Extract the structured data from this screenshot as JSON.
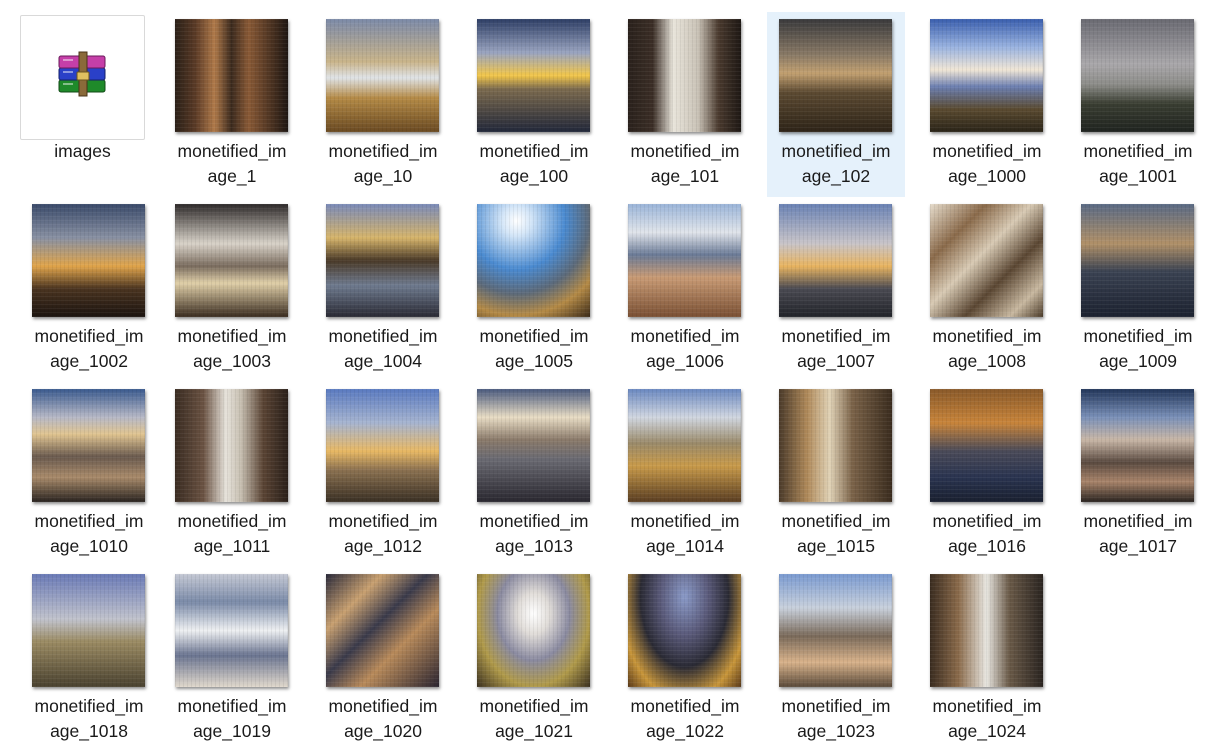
{
  "items": [
    {
      "type": "archive",
      "label": "images",
      "icon": "winrar-archive-icon"
    },
    {
      "type": "image",
      "l1": "monetified_im",
      "l2": "age_1",
      "bg": "linear-gradient(90deg,#2a2018 0%,#5a3a26 18%,#b07a4a 35%,#3b2a1e 50%,#8a5a36 65%,#1e1612 100%)"
    },
    {
      "type": "image",
      "l1": "monetified_im",
      "l2": "age_10",
      "bg": "linear-gradient(180deg,#7c8aa8 0%,#c9b48a 38%,#dfe3e6 52%,#b48a46 70%,#6a4a22 100%)"
    },
    {
      "type": "image",
      "l1": "monetified_im",
      "l2": "age_100",
      "bg": "linear-gradient(180deg,#2e3f66 0%,#9aa4c0 30%,#f2c64a 50%,#7b6a4e 62%,#22283a 100%)"
    },
    {
      "type": "image",
      "l1": "monetified_im",
      "l2": "age_101",
      "bg": "linear-gradient(90deg,#2a211c 0%,#3b2e26 22%,#e8e4da 40%,#c9c2b6 62%,#4a3a2e 80%,#1e1814 100%)"
    },
    {
      "type": "image",
      "l1": "monetified_im",
      "l2": "age_102",
      "bg": "linear-gradient(180deg,#3a3a3c 0%,#8a7a66 32%,#c2a070 48%,#5c4a32 65%,#2e2418 100%)",
      "selected": true
    },
    {
      "type": "image",
      "l1": "monetified_im",
      "l2": "age_1000",
      "bg": "linear-gradient(180deg,#3a5fae 0%,#9ab3e0 25%,#f0e6d6 45%,#6b7eb0 60%,#5a4a30 80%,#2a2418 100%)"
    },
    {
      "type": "image",
      "l1": "monetified_im",
      "l2": "age_1001",
      "bg": "linear-gradient(180deg,#6a6a72 0%,#a9a7aa 40%,#8c8c88 58%,#3a3e32 75%,#202420 100%)"
    },
    {
      "type": "image",
      "l1": "monetified_im",
      "l2": "age_1002",
      "bg": "linear-gradient(180deg,#3a4a6a 0%,#8890a2 30%,#e0a44a 55%,#4a3420 75%,#1c1410 100%)"
    },
    {
      "type": "image",
      "l1": "monetified_im",
      "l2": "age_1003",
      "bg": "linear-gradient(180deg,#2e2a2a 0%,#d8d2c8 35%,#7a6c5e 55%,#e0cfa8 70%,#3a2c20 100%)"
    },
    {
      "type": "image",
      "l1": "monetified_im",
      "l2": "age_1004",
      "bg": "linear-gradient(180deg,#7a8ab8 0%,#d6b46a 30%,#4a3a28 50%,#6e7a8e 72%,#2a2a34 100%)"
    },
    {
      "type": "image",
      "l1": "monetified_im",
      "l2": "age_1005",
      "bg": "radial-gradient(circle at 35% 15%,#ffffff 0%,#d4e6f8 12%,#4a8ad0 40%,#5c6a7a 60%,#b48a46 78%,#3a2a18 100%)"
    },
    {
      "type": "image",
      "l1": "monetified_im",
      "l2": "age_1006",
      "bg": "linear-gradient(180deg,#9ab4d8 0%,#e0e4ea 25%,#6a7a96 45%,#c89a74 65%,#7a5034 100%)"
    },
    {
      "type": "image",
      "l1": "monetified_im",
      "l2": "age_1007",
      "bg": "linear-gradient(180deg,#6a82b4 0%,#c8c4c8 35%,#e8b460 55%,#4a4a52 75%,#22242a 100%)"
    },
    {
      "type": "image",
      "l1": "monetified_im",
      "l2": "age_1008",
      "bg": "linear-gradient(135deg,#e6dccc 0%,#8a6a4a 25%,#d8cab4 45%,#5a4632 65%,#c8b8a0 85%,#4a3a28 100%)"
    },
    {
      "type": "image",
      "l1": "monetified_im",
      "l2": "age_1009",
      "bg": "linear-gradient(180deg,#5a6a84 0%,#b09068 35%,#3a4252 60%,#1c2230 100%)"
    },
    {
      "type": "image",
      "l1": "monetified_im",
      "l2": "age_1010",
      "bg": "linear-gradient(180deg,#3a5a8e 0%,#b6b8c6 25%,#e0c490 40%,#6a5a4e 60%,#a88a6a 78%,#2a2420 100%)"
    },
    {
      "type": "image",
      "l1": "monetified_im",
      "l2": "age_1011",
      "bg": "linear-gradient(90deg,#3a2c22 0%,#6a5242 25%,#e6e2da 45%,#c8c0b2 58%,#5a4434 78%,#2a201a 100%)"
    },
    {
      "type": "image",
      "l1": "monetified_im",
      "l2": "age_1012",
      "bg": "linear-gradient(180deg,#5a7ac0 0%,#a6b4d0 30%,#e8b864 55%,#8a7050 72%,#3a3024 100%)"
    },
    {
      "type": "image",
      "l1": "monetified_im",
      "l2": "age_1013",
      "bg": "linear-gradient(180deg,#4a5a7e 0%,#e8dcc4 25%,#8a7a6a 45%,#6a6a72 62%,#2a2830 100%)"
    },
    {
      "type": "image",
      "l1": "monetified_im",
      "l2": "age_1014",
      "bg": "linear-gradient(180deg,#6a88c0 0%,#d0d6e0 25%,#9a8a6a 48%,#c89a4a 68%,#5a3e22 100%)"
    },
    {
      "type": "image",
      "l1": "monetified_im",
      "l2": "age_1015",
      "bg": "linear-gradient(90deg,#4a3a2a 0%,#b08a5a 25%,#e0d2b6 45%,#7a6248 65%,#3a2c1e 100%)"
    },
    {
      "type": "image",
      "l1": "monetified_im",
      "l2": "age_1016",
      "bg": "linear-gradient(180deg,#8a5a2a 0%,#c8843a 30%,#4a4a58 55%,#2a3450 78%,#1a2030 100%)"
    },
    {
      "type": "image",
      "l1": "monetified_im",
      "l2": "age_1017",
      "bg": "linear-gradient(180deg,#22365a 0%,#7a90b8 25%,#c8b6a6 45%,#5a4a40 65%,#a8846a 82%,#2a2420 100%)"
    },
    {
      "type": "image",
      "l1": "monetified_im",
      "l2": "age_1018",
      "bg": "linear-gradient(180deg,#6a7ab6 0%,#c0c2cc 40%,#9a8a62 60%,#4a4230 100%)"
    },
    {
      "type": "image",
      "l1": "monetified_im",
      "l2": "age_1019",
      "bg": "linear-gradient(180deg,#c4c8d4 0%,#7a8aa8 25%,#eef0f2 50%,#6a7490 72%,#e0d8cc 100%)"
    },
    {
      "type": "image",
      "l1": "monetified_im",
      "l2": "age_1020",
      "bg": "linear-gradient(135deg,#2a2a3a 0%,#c8a070 25%,#3a3a4a 45%,#b88a5a 65%,#2a2430 100%)"
    },
    {
      "type": "image",
      "l1": "monetified_im",
      "l2": "age_1021",
      "bg": "radial-gradient(ellipse at 50% 35%,#ffffff 0%,#e0dcd8 20%,#8a8aa0 45%,#b09a4a 70%,#3a3020 100%)"
    },
    {
      "type": "image",
      "l1": "monetified_im",
      "l2": "age_1022",
      "bg": "radial-gradient(ellipse at 50% 20%,#8a9ac8 0%,#5a5a7a 30%,#2a2a34 55%,#c8963a 80%,#5a3a1a 100%)"
    },
    {
      "type": "image",
      "l1": "monetified_im",
      "l2": "age_1023",
      "bg": "linear-gradient(180deg,#7a9ad0 0%,#c8d0dc 30%,#7a6a5a 55%,#d8b28a 78%,#5a4a3a 100%)"
    },
    {
      "type": "image",
      "l1": "monetified_im",
      "l2": "age_1024",
      "bg": "linear-gradient(90deg,#3a2c20 0%,#8a6a4a 25%,#e8e6e0 50%,#6a5a48 70%,#2a2420 100%)"
    }
  ]
}
